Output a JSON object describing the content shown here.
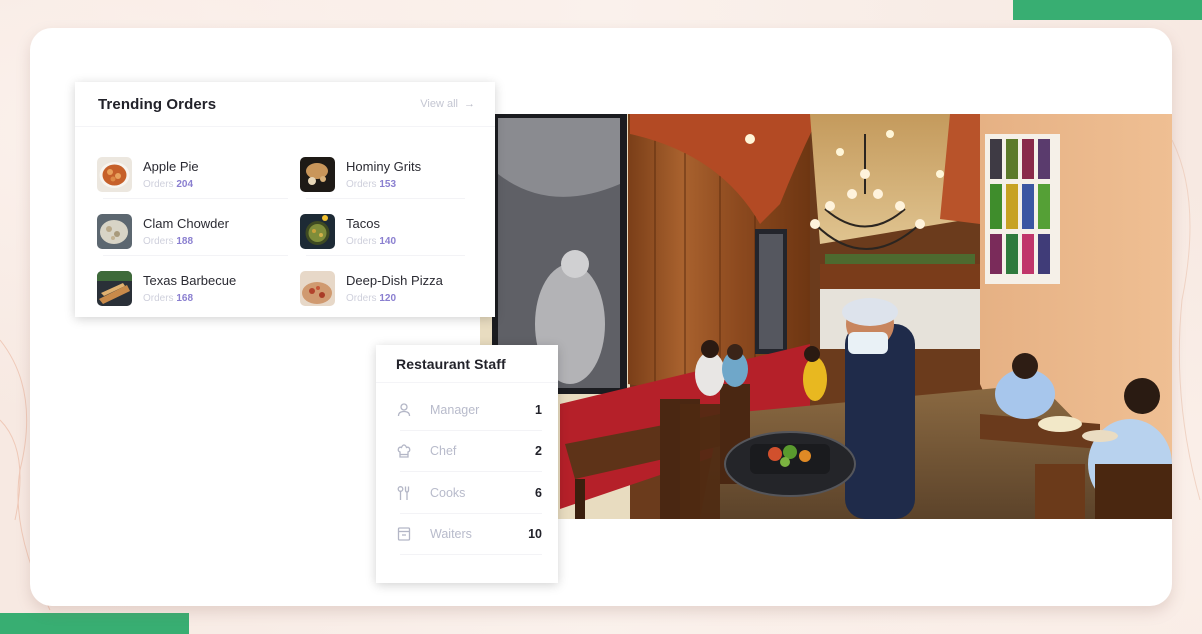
{
  "trending_orders": {
    "title": "Trending Orders",
    "view_all_label": "View all",
    "view_all_icon": "arrow-right-icon",
    "orders_label": "Orders",
    "items": [
      {
        "name": "Apple Pie",
        "orders": "204",
        "thumb": "apple-pie-photo"
      },
      {
        "name": "Hominy Grits",
        "orders": "153",
        "thumb": "hominy-grits-photo"
      },
      {
        "name": "Clam Chowder",
        "orders": "188",
        "thumb": "clam-chowder-photo"
      },
      {
        "name": "Tacos",
        "orders": "140",
        "thumb": "tacos-photo"
      },
      {
        "name": "Texas Barbecue",
        "orders": "168",
        "thumb": "texas-barbecue-photo"
      },
      {
        "name": "Deep-Dish Pizza",
        "orders": "120",
        "thumb": "deep-dish-pizza-photo"
      }
    ]
  },
  "restaurant_staff": {
    "title": "Restaurant Staff",
    "rows": [
      {
        "label": "Manager",
        "count": "1",
        "icon": "user-icon"
      },
      {
        "label": "Chef",
        "count": "2",
        "icon": "chef-hat-icon"
      },
      {
        "label": "Cooks",
        "count": "6",
        "icon": "utensils-icon"
      },
      {
        "label": "Waiters",
        "count": "10",
        "icon": "archive-box-icon"
      }
    ]
  },
  "photo": {
    "description": "Restaurant interior with masked waiter carrying a serving tray"
  },
  "colors": {
    "accent_green": "#38ae72",
    "order_count": "#8a7fd0",
    "muted_text": "#c4c6d2"
  }
}
